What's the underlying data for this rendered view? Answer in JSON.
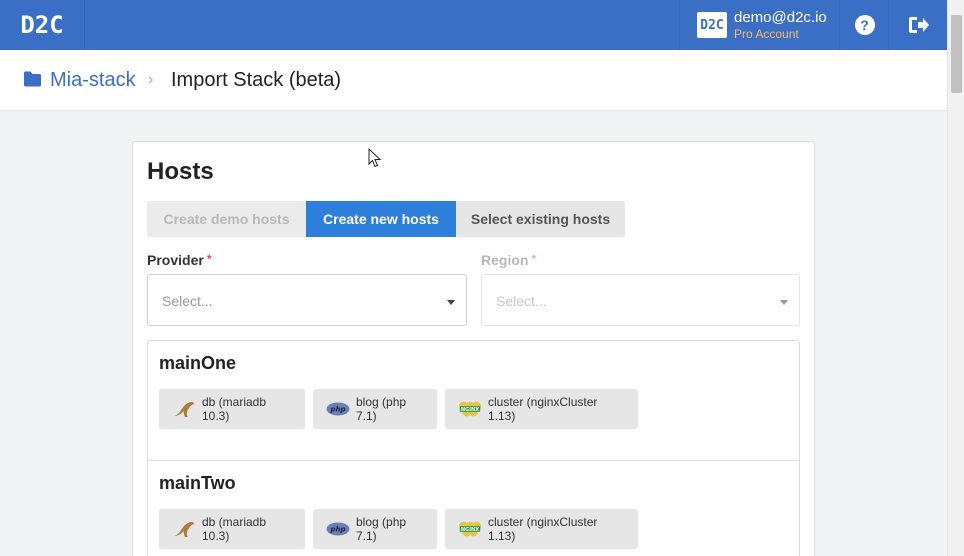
{
  "topbar": {
    "logo_text": "D2C",
    "avatar_text": "D2C",
    "user_email": "demo@d2c.io",
    "user_plan": "Pro Account",
    "help_icon_glyph": "?",
    "accent_color": "#3b6fc5",
    "plan_color": "#f6b96a"
  },
  "breadcrumb": {
    "parent": "Mia-stack",
    "separator": "›",
    "current": "Import Stack (beta)"
  },
  "card": {
    "title": "Hosts",
    "tabs": [
      {
        "label": "Create demo hosts",
        "state": "disabled"
      },
      {
        "label": "Create new hosts",
        "state": "active"
      },
      {
        "label": "Select existing hosts",
        "state": "inactive"
      }
    ],
    "provider": {
      "label": "Provider",
      "required_mark": "*",
      "placeholder": "Select..."
    },
    "region": {
      "label": "Region",
      "required_mark": "*",
      "placeholder": "Select..."
    },
    "hosts": [
      {
        "name": "mainOne",
        "services": [
          {
            "label": "db (mariadb 10.3)",
            "icon": "mariadb-seal-icon"
          },
          {
            "label": "blog (php 7.1)",
            "icon": "php-icon"
          },
          {
            "label": "cluster (nginxCluster 1.13)",
            "icon": "nginx-icon"
          }
        ]
      },
      {
        "name": "mainTwo",
        "services": [
          {
            "label": "db (mariadb 10.3)",
            "icon": "mariadb-seal-icon"
          },
          {
            "label": "blog (php 7.1)",
            "icon": "php-icon"
          },
          {
            "label": "cluster (nginxCluster 1.13)",
            "icon": "nginx-icon"
          }
        ]
      }
    ],
    "active_tab_color": "#2d7fd9"
  }
}
